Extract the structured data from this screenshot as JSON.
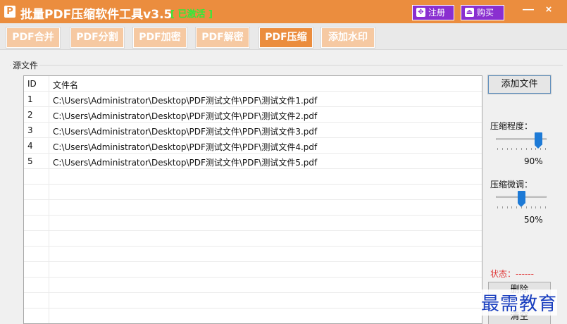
{
  "window": {
    "title": "批量PDF压缩软件工具v3.5",
    "status": "[ 已激活 ]",
    "register_label": "注册",
    "buy_label": "购买",
    "minimize_glyph": "—",
    "close_glyph": "×",
    "app_icon_glyph": "P"
  },
  "tabs": [
    {
      "label": "PDF合并",
      "active": false
    },
    {
      "label": "PDF分割",
      "active": false
    },
    {
      "label": "PDF加密",
      "active": false
    },
    {
      "label": "PDF解密",
      "active": false
    },
    {
      "label": "PDF压缩",
      "active": true
    },
    {
      "label": "添加水印",
      "active": false
    }
  ],
  "source": {
    "group_label": "源文件",
    "columns": [
      "ID",
      "文件名"
    ],
    "rows": [
      {
        "id": "1",
        "name": "C:\\Users\\Administrator\\Desktop\\PDF测试文件\\PDF\\测试文件1.pdf"
      },
      {
        "id": "2",
        "name": "C:\\Users\\Administrator\\Desktop\\PDF测试文件\\PDF\\测试文件2.pdf"
      },
      {
        "id": "3",
        "name": "C:\\Users\\Administrator\\Desktop\\PDF测试文件\\PDF\\测试文件3.pdf"
      },
      {
        "id": "4",
        "name": "C:\\Users\\Administrator\\Desktop\\PDF测试文件\\PDF\\测试文件4.pdf"
      },
      {
        "id": "5",
        "name": "C:\\Users\\Administrator\\Desktop\\PDF测试文件\\PDF\\测试文件5.pdf"
      }
    ]
  },
  "panel": {
    "add_file_label": "添加文件",
    "compression_level_label": "压缩程度：",
    "compression_level_value": "90%",
    "compression_level": 0.9,
    "fine_tune_label": "压缩微调：",
    "fine_tune_value": "50%",
    "fine_tune": 0.5,
    "status_label": "状态：------",
    "delete_label": "删除",
    "clear_label": "清空"
  },
  "watermark": "最需教育",
  "colors": {
    "accent": "#eb8d3e",
    "tab_inactive": "#f6c9a2",
    "button_purple": "#8a2fd0",
    "status_green": "#33e83a",
    "status_red": "#e04040",
    "slider_blue": "#1d7ad6",
    "watermark_blue": "#1a3fbf"
  }
}
